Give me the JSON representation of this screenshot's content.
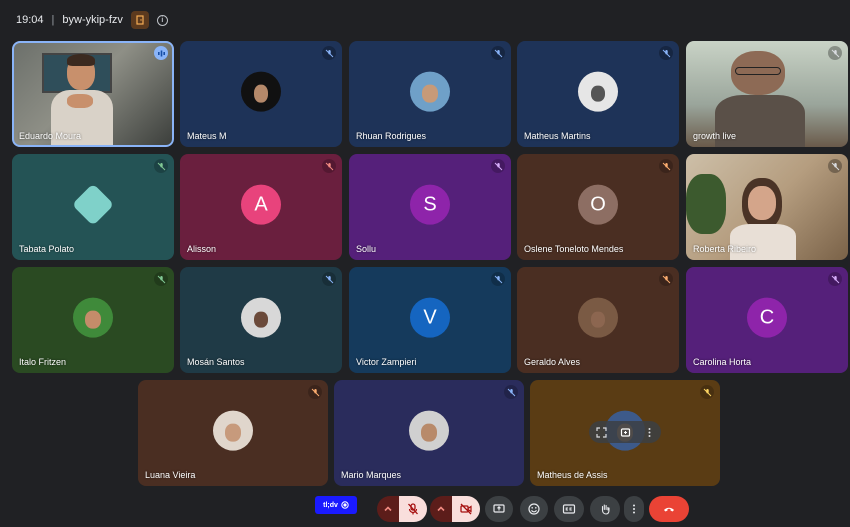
{
  "topbar": {
    "time": "19:04",
    "separator": "|",
    "meeting_code": "byw-ykip-fzv"
  },
  "participants": [
    {
      "name": "Eduardo Moura"
    },
    {
      "name": "Mateus M"
    },
    {
      "name": "Rhuan Rodrigues"
    },
    {
      "name": "Matheus Martins"
    },
    {
      "name": "growth live"
    },
    {
      "name": "Tabata Polato"
    },
    {
      "name": "Alisson",
      "initial": "A"
    },
    {
      "name": "Sollu",
      "initial": "S"
    },
    {
      "name": "Oslene Toneloto Mendes",
      "initial": "O"
    },
    {
      "name": "Roberta Ribeiro"
    },
    {
      "name": "Italo Fritzen"
    },
    {
      "name": "Mosán Santos"
    },
    {
      "name": "Victor Zampieri",
      "initial": "V"
    },
    {
      "name": "Geraldo Alves"
    },
    {
      "name": "Carolina Horta",
      "initial": "C"
    },
    {
      "name": "Luana Vieira"
    },
    {
      "name": "Mario Marques"
    },
    {
      "name": "Matheus de Assis"
    }
  ],
  "present_chip": {
    "label": "tl;dv"
  },
  "colors": {
    "background": "#202124",
    "end_call": "#ea4335",
    "muted_control": "#f9dedc",
    "speaking": "#8ab4f8"
  }
}
